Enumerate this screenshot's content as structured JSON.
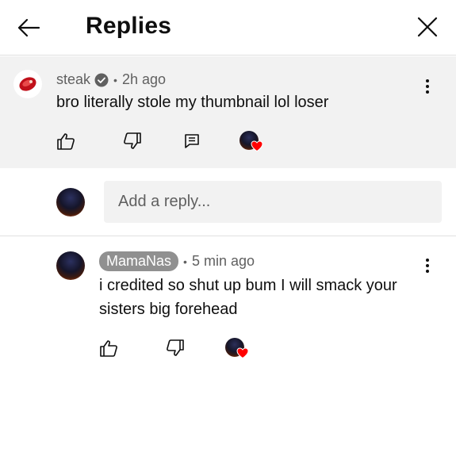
{
  "header": {
    "title": "Replies",
    "back_icon": "arrow-left-icon",
    "close_icon": "close-icon"
  },
  "parent_comment": {
    "author": "steak",
    "verified": true,
    "separator": "•",
    "time": "2h ago",
    "text": "bro literally stole my thumbnail lol loser",
    "avatar_icon": "steak-icon",
    "actions": [
      "like-icon",
      "dislike-icon",
      "reply-icon",
      "creator-heart-icon"
    ]
  },
  "reply_box": {
    "placeholder": "Add a reply..."
  },
  "replies": [
    {
      "author": "MamaNas",
      "separator": "•",
      "time": "5 min ago",
      "text": "i credited so shut up bum I will smack your sisters big forehead",
      "actions": [
        "like-icon",
        "dislike-icon",
        "creator-heart-icon"
      ]
    }
  ],
  "colors": {
    "accent_heart": "#ff0000",
    "meta_text": "#606060",
    "chip_bg": "#909090",
    "panel_bg": "#f2f2f2"
  }
}
